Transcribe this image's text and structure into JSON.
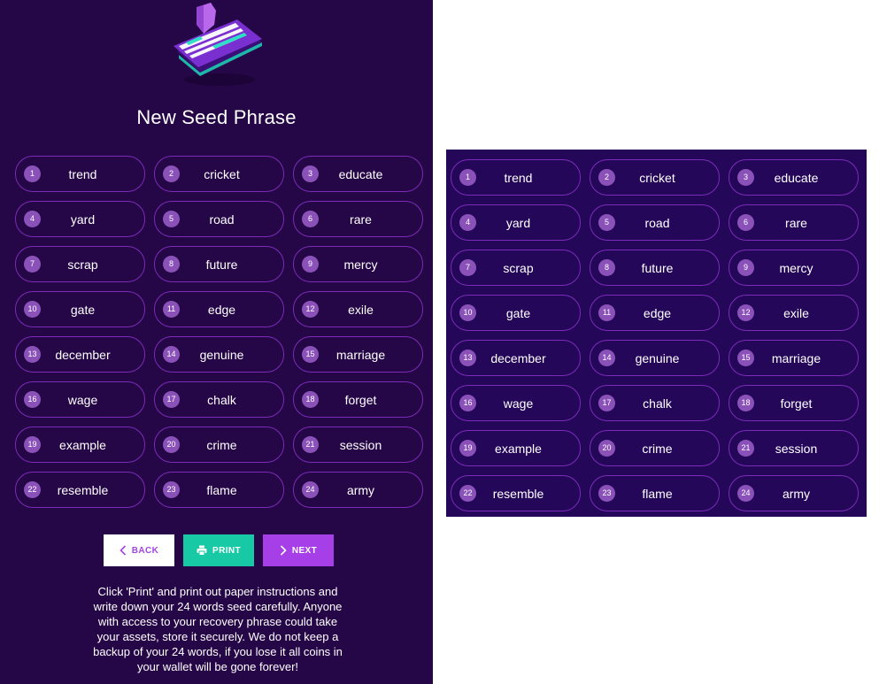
{
  "title": "New Seed Phrase",
  "words": [
    {
      "n": "1",
      "w": "trend"
    },
    {
      "n": "2",
      "w": "cricket"
    },
    {
      "n": "3",
      "w": "educate"
    },
    {
      "n": "4",
      "w": "yard"
    },
    {
      "n": "5",
      "w": "road"
    },
    {
      "n": "6",
      "w": "rare"
    },
    {
      "n": "7",
      "w": "scrap"
    },
    {
      "n": "8",
      "w": "future"
    },
    {
      "n": "9",
      "w": "mercy"
    },
    {
      "n": "10",
      "w": "gate"
    },
    {
      "n": "11",
      "w": "edge"
    },
    {
      "n": "12",
      "w": "exile"
    },
    {
      "n": "13",
      "w": "december"
    },
    {
      "n": "14",
      "w": "genuine"
    },
    {
      "n": "15",
      "w": "marriage"
    },
    {
      "n": "16",
      "w": "wage"
    },
    {
      "n": "17",
      "w": "chalk"
    },
    {
      "n": "18",
      "w": "forget"
    },
    {
      "n": "19",
      "w": "example"
    },
    {
      "n": "20",
      "w": "crime"
    },
    {
      "n": "21",
      "w": "session"
    },
    {
      "n": "22",
      "w": "resemble"
    },
    {
      "n": "23",
      "w": "flame"
    },
    {
      "n": "24",
      "w": "army"
    }
  ],
  "buttons": {
    "back_label": "BACK",
    "print_label": "PRINT",
    "next_label": "NEXT"
  },
  "icons": {
    "hero": "shield-document-illustration",
    "back": "chevron-left-icon",
    "print": "printer-icon",
    "next": "chevron-right-icon"
  },
  "instructions": "Click 'Print' and print out paper instructions and write down your 24 words seed carefully. Anyone with access to your recovery phrase could take your assets, store it securely. We do not keep a backup of your 24 words, if you lose it all coins in your wallet will be gone forever!",
  "colors": {
    "panel_bg": "#250646",
    "pill_border": "#7b2bb8",
    "number_badge": "#8a52b8",
    "print_button": "#17c9a5",
    "next_button": "#a63fe8"
  }
}
